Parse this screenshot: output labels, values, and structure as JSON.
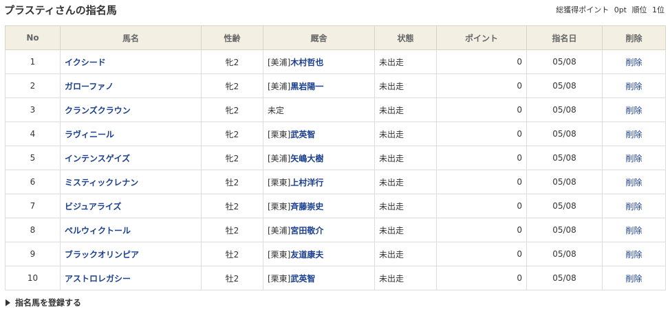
{
  "header": {
    "title": "プラスティさんの指名馬",
    "total_points_label": "総獲得ポイント",
    "total_points_value": "0pt",
    "rank_label": "順位",
    "rank_value": "1位"
  },
  "table": {
    "columns": [
      "No",
      "馬名",
      "性齢",
      "厩舎",
      "状態",
      "ポイント",
      "指名日",
      "削除"
    ],
    "rows": [
      {
        "no": "1",
        "name": "イクシード",
        "sex_age": "牝2",
        "stable_region": "[美浦]",
        "trainer": "木村哲也",
        "status": "未出走",
        "points": "0",
        "date": "05/08",
        "delete": "削除"
      },
      {
        "no": "2",
        "name": "ガローファノ",
        "sex_age": "牝2",
        "stable_region": "[美浦]",
        "trainer": "黒岩陽一",
        "status": "未出走",
        "points": "0",
        "date": "05/08",
        "delete": "削除"
      },
      {
        "no": "3",
        "name": "クランズクラウン",
        "sex_age": "牝2",
        "stable_region": "未定",
        "trainer": "",
        "status": "未出走",
        "points": "0",
        "date": "05/08",
        "delete": "削除"
      },
      {
        "no": "4",
        "name": "ラヴィニール",
        "sex_age": "牝2",
        "stable_region": "[栗東]",
        "trainer": "武英智",
        "status": "未出走",
        "points": "0",
        "date": "05/08",
        "delete": "削除"
      },
      {
        "no": "5",
        "name": "インテンスゲイズ",
        "sex_age": "牝2",
        "stable_region": "[美浦]",
        "trainer": "矢嶋大樹",
        "status": "未出走",
        "points": "0",
        "date": "05/08",
        "delete": "削除"
      },
      {
        "no": "6",
        "name": "ミスティックレナン",
        "sex_age": "牡2",
        "stable_region": "[栗東]",
        "trainer": "上村洋行",
        "status": "未出走",
        "points": "0",
        "date": "05/08",
        "delete": "削除"
      },
      {
        "no": "7",
        "name": "ビジュアライズ",
        "sex_age": "牡2",
        "stable_region": "[栗東]",
        "trainer": "斉藤崇史",
        "status": "未出走",
        "points": "0",
        "date": "05/08",
        "delete": "削除"
      },
      {
        "no": "8",
        "name": "ペルウィクトール",
        "sex_age": "牡2",
        "stable_region": "[美浦]",
        "trainer": "宮田敬介",
        "status": "未出走",
        "points": "0",
        "date": "05/08",
        "delete": "削除"
      },
      {
        "no": "9",
        "name": "ブラックオリンピア",
        "sex_age": "牡2",
        "stable_region": "[栗東]",
        "trainer": "友道康夫",
        "status": "未出走",
        "points": "0",
        "date": "05/08",
        "delete": "削除"
      },
      {
        "no": "10",
        "name": "アストロレガシー",
        "sex_age": "牡2",
        "stable_region": "[栗東]",
        "trainer": "武英智",
        "status": "未出走",
        "points": "0",
        "date": "05/08",
        "delete": "削除"
      }
    ]
  },
  "footer": {
    "register_label": "指名馬を登録する"
  },
  "colors": {
    "header_bg": "#f3efe3",
    "link": "#1a3f8f",
    "border": "#dddddd"
  }
}
